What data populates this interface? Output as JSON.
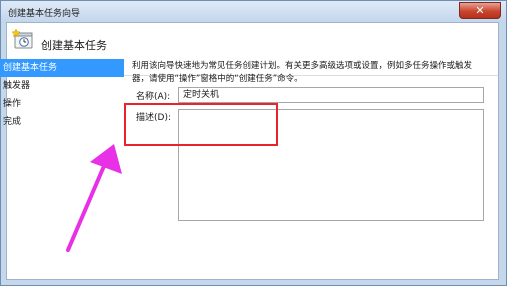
{
  "window": {
    "title": "创建基本任务向导"
  },
  "header": {
    "title": "创建基本任务",
    "icon": "task-clock-icon"
  },
  "nav": {
    "items": [
      {
        "label": "创建基本任务",
        "active": true
      },
      {
        "label": "触发器",
        "active": false
      },
      {
        "label": "操作",
        "active": false
      },
      {
        "label": "完成",
        "active": false
      }
    ]
  },
  "main": {
    "description_line1": "利用该向导快速地为常见任务创建计划。有关更多高级选项或设置，例如多任务操作或触发",
    "description_line2": "器，请使用“操作”窗格中的“创建任务”命令。",
    "name_label": "名称(A):",
    "name_value": "定时关机",
    "desc_label": "描述(D):"
  },
  "colors": {
    "highlight_box": "#e8232d",
    "annotation_arrow": "#e830e6",
    "selection": "#3399ff"
  }
}
